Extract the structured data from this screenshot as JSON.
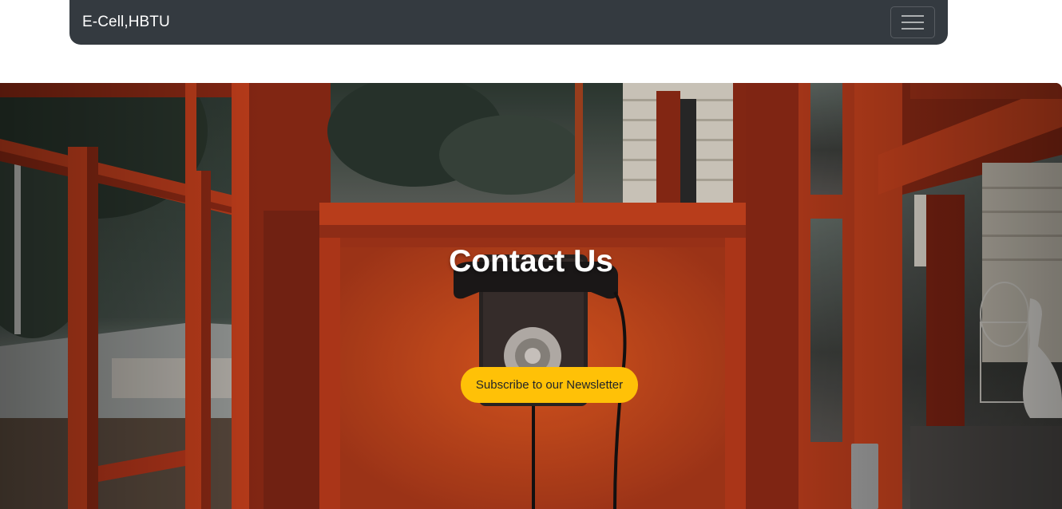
{
  "navbar": {
    "brand": "E-Cell,HBTU",
    "toggler_icon": "hamburger-menu-icon"
  },
  "hero": {
    "title": "Contact Us",
    "button_label": "Subscribe to our Newsletter",
    "background_image": "red-phone-booth-interior-photo"
  },
  "colors": {
    "navbar_bg": "#343a40",
    "button_bg": "#ffc107",
    "button_text": "#212529",
    "title_text": "#ffffff"
  }
}
